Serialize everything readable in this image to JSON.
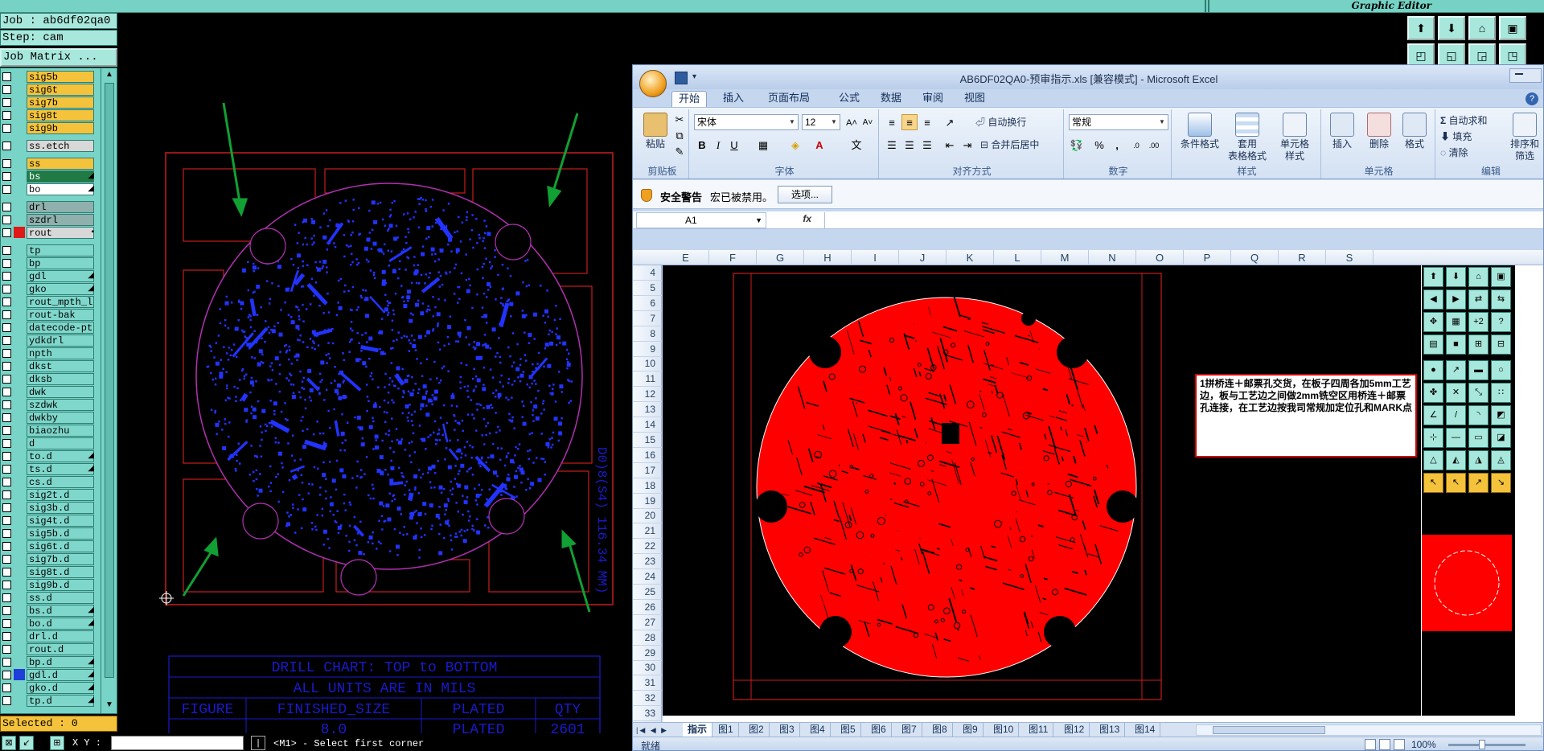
{
  "genesis": {
    "title": "Graphic Editor",
    "job_label": "Job : ab6df02qa0",
    "step_label": "Step: cam",
    "job_matrix_button": "Job Matrix ...",
    "selected_label": "Selected : 0",
    "xy_label": "X Y :",
    "status_message": "<M1> - Select first corner",
    "layers": [
      {
        "name": "sig5b",
        "style": "sig",
        "gap": false,
        "flag": ""
      },
      {
        "name": "sig6t",
        "style": "sig",
        "gap": false,
        "flag": ""
      },
      {
        "name": "sig7b",
        "style": "sig",
        "gap": false,
        "flag": ""
      },
      {
        "name": "sig8t",
        "style": "sig",
        "gap": false,
        "flag": ""
      },
      {
        "name": "sig9b",
        "style": "sig",
        "gap": false,
        "flag": ""
      },
      {
        "name": "ss.etch",
        "style": "light",
        "gap": true,
        "flag": ""
      },
      {
        "name": "ss",
        "style": "sig",
        "gap": true,
        "flag": ""
      },
      {
        "name": "bs",
        "style": "green",
        "gap": false,
        "flag": "◢"
      },
      {
        "name": "bo",
        "style": "white",
        "gap": false,
        "flag": "◢"
      },
      {
        "name": "drl",
        "style": "gray",
        "gap": true,
        "flag": ""
      },
      {
        "name": "szdrl",
        "style": "gray",
        "gap": false,
        "flag": ""
      },
      {
        "name": "rout",
        "style": "light",
        "gap": false,
        "flag": "▪"
      },
      {
        "name": "tp",
        "style": "normal",
        "gap": true,
        "flag": ""
      },
      {
        "name": "bp",
        "style": "normal",
        "gap": false,
        "flag": ""
      },
      {
        "name": "gdl",
        "style": "normal",
        "gap": false,
        "flag": "◢"
      },
      {
        "name": "gko",
        "style": "normal",
        "gap": false,
        "flag": "◢"
      },
      {
        "name": "rout_mpth_la",
        "style": "normal",
        "gap": false,
        "flag": ""
      },
      {
        "name": "rout-bak",
        "style": "normal",
        "gap": false,
        "flag": ""
      },
      {
        "name": "datecode-pte",
        "style": "normal",
        "gap": false,
        "flag": ""
      },
      {
        "name": "ydkdrl",
        "style": "normal",
        "gap": false,
        "flag": ""
      },
      {
        "name": "npth",
        "style": "normal",
        "gap": false,
        "flag": ""
      },
      {
        "name": "dkst",
        "style": "normal",
        "gap": false,
        "flag": ""
      },
      {
        "name": "dksb",
        "style": "normal",
        "gap": false,
        "flag": ""
      },
      {
        "name": "dwk",
        "style": "normal",
        "gap": false,
        "flag": ""
      },
      {
        "name": "szdwk",
        "style": "normal",
        "gap": false,
        "flag": ""
      },
      {
        "name": "dwkby",
        "style": "normal",
        "gap": false,
        "flag": ""
      },
      {
        "name": "biaozhu",
        "style": "normal",
        "gap": false,
        "flag": ""
      },
      {
        "name": "d",
        "style": "normal",
        "gap": false,
        "flag": ""
      },
      {
        "name": "to.d",
        "style": "normal",
        "gap": false,
        "flag": "◢"
      },
      {
        "name": "ts.d",
        "style": "normal",
        "gap": false,
        "flag": "◢"
      },
      {
        "name": "cs.d",
        "style": "normal",
        "gap": false,
        "flag": ""
      },
      {
        "name": "sig2t.d",
        "style": "normal",
        "gap": false,
        "flag": ""
      },
      {
        "name": "sig3b.d",
        "style": "normal",
        "gap": false,
        "flag": ""
      },
      {
        "name": "sig4t.d",
        "style": "normal",
        "gap": false,
        "flag": ""
      },
      {
        "name": "sig5b.d",
        "style": "normal",
        "gap": false,
        "flag": ""
      },
      {
        "name": "sig6t.d",
        "style": "normal",
        "gap": false,
        "flag": ""
      },
      {
        "name": "sig7b.d",
        "style": "normal",
        "gap": false,
        "flag": ""
      },
      {
        "name": "sig8t.d",
        "style": "normal",
        "gap": false,
        "flag": ""
      },
      {
        "name": "sig9b.d",
        "style": "normal",
        "gap": false,
        "flag": ""
      },
      {
        "name": "ss.d",
        "style": "normal",
        "gap": false,
        "flag": ""
      },
      {
        "name": "bs.d",
        "style": "normal",
        "gap": false,
        "flag": "◢"
      },
      {
        "name": "bo.d",
        "style": "normal",
        "gap": false,
        "flag": "◢"
      },
      {
        "name": "drl.d",
        "style": "normal",
        "gap": false,
        "flag": ""
      },
      {
        "name": "rout.d",
        "style": "normal",
        "gap": false,
        "flag": ""
      },
      {
        "name": "bp.d",
        "style": "normal",
        "gap": false,
        "flag": "◢"
      },
      {
        "name": "gdl.d",
        "style": "normal",
        "gap": false,
        "flag": "◢"
      },
      {
        "name": "gko.d",
        "style": "normal",
        "gap": false,
        "flag": "◢"
      },
      {
        "name": "tp.d",
        "style": "normal",
        "gap": false,
        "flag": "◢"
      }
    ],
    "colors": {
      "board_outline": "#7a1a8a",
      "copper": "#2233ff",
      "arrow": "#11a033",
      "frame": "#c81d1d",
      "chart": "#1a1acc"
    },
    "drill_chart": {
      "title": "DRILL CHART: TOP to BOTTOM",
      "subtitle": "ALL UNITS ARE IN MILS",
      "headers": [
        "FIGURE",
        "FINISHED_SIZE",
        "PLATED",
        "QTY"
      ],
      "row": [
        "",
        "8.0",
        "PLATED",
        "2601"
      ]
    },
    "dimension_text": "D0)8(S4) 116.34 MM)"
  },
  "excel": {
    "title": "AB6DF02QA0-预审指示.xls  [兼容模式] - Microsoft Excel",
    "tabs": [
      "开始",
      "插入",
      "页面布局",
      "公式",
      "数据",
      "审阅",
      "视图"
    ],
    "ribbon": {
      "paste": "粘贴",
      "clipboard": "剪贴板",
      "font_name": "宋体",
      "font_size": "12",
      "font_group": "字体",
      "wrap": "自动换行",
      "merge": "合并后居中",
      "align_group": "对齐方式",
      "number_format": "常规",
      "number_group": "数字",
      "cond_format": "条件格式",
      "table_format_1": "套用",
      "table_format_2": "表格格式",
      "cell_style_1": "单元格",
      "cell_style_2": "样式",
      "style_group": "样式",
      "insert": "插入",
      "delete": "删除",
      "format": "格式",
      "cells_group": "单元格",
      "autosum": "自动求和",
      "fill": "填充",
      "clear": "清除",
      "sort_1": "排序和",
      "sort_2": "筛选",
      "edit_group": "编辑"
    },
    "security": {
      "title": "安全警告",
      "text": "宏已被禁用。",
      "button": "选项..."
    },
    "name_box": "A1",
    "fx": "fx",
    "columns": [
      "E",
      "F",
      "G",
      "H",
      "I",
      "J",
      "K",
      "L",
      "M",
      "N",
      "O",
      "P",
      "Q",
      "R",
      "S"
    ],
    "rows": [
      "4",
      "5",
      "6",
      "7",
      "8",
      "9",
      "10",
      "11",
      "12",
      "13",
      "14",
      "15",
      "16",
      "17",
      "18",
      "19",
      "20",
      "21",
      "22",
      "23",
      "24",
      "25",
      "26",
      "27",
      "28",
      "29",
      "30",
      "31",
      "32",
      "33"
    ],
    "note": "1拼桥连＋邮票孔交货，在板子四周各加5mm工艺边，板与工艺边之间做2mm铣空区用桥连＋邮票孔连接，在工艺边按我司常规加定位孔和MARK点",
    "sheet_tabs": [
      "指示",
      "图1",
      "图2",
      "图3",
      "图4",
      "图5",
      "图6",
      "图7",
      "图8",
      "图9",
      "图10",
      "图11",
      "图12",
      "图13",
      "图14"
    ],
    "status": "就绪",
    "zoom": "100%",
    "colors": {
      "board_fill": "#ff0000",
      "accent": "#15305a"
    }
  }
}
